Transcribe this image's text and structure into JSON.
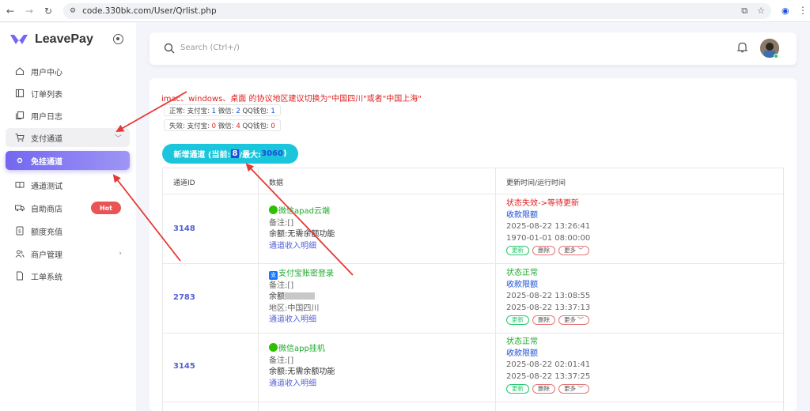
{
  "browser": {
    "url": "code.330bk.com/User/Qrlist.php",
    "back_icon": "back-arrow-icon",
    "forward_icon": "forward-arrow-icon",
    "reload_icon": "reload-icon"
  },
  "sidebar": {
    "brand": "LeavePay",
    "items": [
      {
        "label": "用户中心",
        "icon": "home-icon"
      },
      {
        "label": "订单列表",
        "icon": "list-icon"
      },
      {
        "label": "用户日志",
        "icon": "copy-icon"
      },
      {
        "label": "支付通道",
        "icon": "cart-icon"
      },
      {
        "label": "免挂通道",
        "icon": "circle-icon"
      },
      {
        "label": "通道测试",
        "icon": "book-icon"
      },
      {
        "label": "自助商店",
        "icon": "truck-icon",
        "badge": "Hot"
      },
      {
        "label": "额度充值",
        "icon": "money-icon"
      },
      {
        "label": "商户管理",
        "icon": "users-icon"
      },
      {
        "label": "工单系统",
        "icon": "file-icon"
      }
    ]
  },
  "topbar": {
    "search_placeholder": "Search (Ctrl+/)"
  },
  "main": {
    "notice": "imac、windows、桌面 的协议地区建议切换为\"中国四川\"或者\"中国上海\"",
    "normal": {
      "prefix": "正常: 支付宝: ",
      "alipay": "1",
      "wx_label": " 微信: ",
      "wechat": "2",
      "qq_label": " QQ钱包: ",
      "qq": "1"
    },
    "invalid": {
      "prefix": "失效: 支付宝: ",
      "alipay": "0",
      "wx_label": " 微信: ",
      "wechat": "4",
      "qq_label": " QQ钱包: ",
      "qq": "0"
    },
    "add_button": {
      "prefix": "新增通道 (当前: ",
      "current": "8",
      "mid": "/最大: ",
      "max": "3060",
      "suffix": ")"
    },
    "table": {
      "headers": [
        "通道ID",
        "数据",
        "更新时间/运行时间"
      ],
      "rows": [
        {
          "id": "3148",
          "type": "微信apad云端",
          "remark": "备注:[]",
          "balance": "余额:无需余额功能",
          "region": "",
          "detail": "通道收入明细",
          "status": "状态失效->等待更新",
          "limit": "收款限额",
          "time1": "2025-08-22 13:26:41",
          "time2": "1970-01-01 08:00:00"
        },
        {
          "id": "2783",
          "type": "支付宝账密登录",
          "remark": "备注:[]",
          "balance": "余额",
          "region": "地区:中国四川",
          "detail": "通道收入明细",
          "status": "状态正常",
          "limit": "收款限额",
          "time1": "2025-08-22 13:08:55",
          "time2": "2025-08-22 13:37:13"
        },
        {
          "id": "3145",
          "type": "微信app挂机",
          "remark": "备注:[]",
          "balance": "余额:无需余额功能",
          "region": "",
          "detail": "通道收入明细",
          "status": "状态正常",
          "limit": "收款限额",
          "time1": "2025-08-22 02:01:41",
          "time2": "2025-08-22 13:37:25"
        }
      ],
      "btn_update": "更新",
      "btn_delete": "删除",
      "btn_more": "更多"
    }
  },
  "colors": {
    "accent": "#7367f0",
    "cyan": "#1bc6dc",
    "error": "#e02020",
    "success": "#1fa830",
    "link": "#5561d6"
  }
}
